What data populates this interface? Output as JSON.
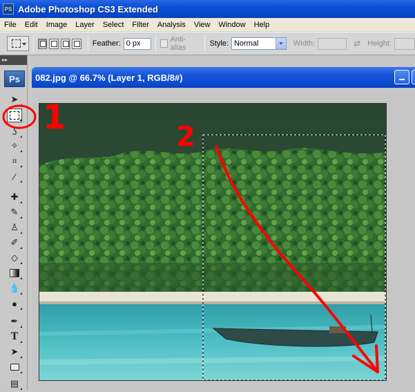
{
  "app": {
    "title": "Adobe Photoshop CS3 Extended",
    "icon": "PS"
  },
  "menu": {
    "items": [
      "File",
      "Edit",
      "Image",
      "Layer",
      "Select",
      "Filter",
      "Analysis",
      "View",
      "Window",
      "Help"
    ]
  },
  "options": {
    "feather_label": "Feather:",
    "feather_value": "0 px",
    "antialias_label": "Anti-alias",
    "style_label": "Style:",
    "style_value": "Normal",
    "width_label": "Width:",
    "height_label": "Height:"
  },
  "toolbox": {
    "header": "▸▸",
    "logo": "Ps",
    "active_tool": "rectangular-marquee",
    "tools": [
      "move",
      "rectangular-marquee",
      "lasso",
      "magic-wand",
      "crop",
      "eyedropper",
      "healing-brush",
      "brush",
      "clone-stamp",
      "history-brush",
      "eraser",
      "gradient",
      "blur",
      "dodge",
      "pen",
      "type",
      "path-selection",
      "rectangle-shape",
      "notes"
    ]
  },
  "document": {
    "title": "082.jpg @ 66.7% (Layer 1, RGB/8#)"
  },
  "annotations": {
    "step1": "1",
    "step2": "2",
    "color": "#ff0000"
  },
  "colors": {
    "xp_blue": "#0a4fd6",
    "sky_dark": "#2e4a34",
    "sea": "#3fb0b8"
  }
}
